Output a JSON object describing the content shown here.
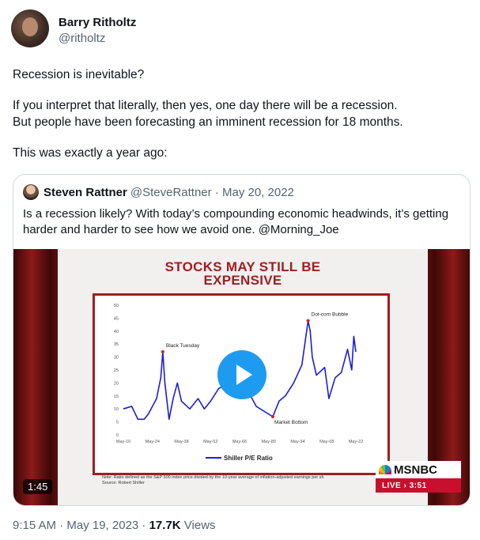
{
  "author": {
    "name": "Barry Ritholtz",
    "handle": "@ritholtz"
  },
  "tweet": {
    "p1": "Recession is inevitable?",
    "p2": "If you interpret that literally, then yes, one day there will be a recession.\nBut people have been forecasting an imminent recession for 18 months.",
    "p3": "This was exactly a year ago:"
  },
  "quote": {
    "name": "Steven Rattner",
    "meta": "@SteveRattner · May 20, 2022",
    "text": "Is a recession likely? With today’s compounding economic headwinds, it’s getting harder and harder to see how we avoid one. @Morning_Joe"
  },
  "video": {
    "slide_title_1": "STOCKS MAY STILL BE",
    "slide_title_2": "EXPENSIVE",
    "duration": "1:45",
    "network": "MSNBC",
    "live": "LIVE › 3:51",
    "note_1": "Note: Ratio defined as the S&P 500 index price divided by the 10-year average of inflation-adjusted earnings per sh",
    "note_2": "Source: Robert Shiller"
  },
  "chart_data": {
    "type": "line",
    "series": [
      {
        "name": "Shiller P/E Ratio",
        "color": "#1a1fd6",
        "x": [
          1910,
          1914,
          1917,
          1920,
          1922,
          1924,
          1926,
          1928,
          1929,
          1930,
          1932,
          1934,
          1936,
          1938,
          1942,
          1946,
          1949,
          1952,
          1956,
          1960,
          1966,
          1970,
          1974,
          1978,
          1980,
          1982,
          1985,
          1988,
          1992,
          1996,
          1999,
          2000,
          2001,
          2003,
          2007,
          2009,
          2012,
          2015,
          2018,
          2020,
          2021,
          2022
        ],
        "y": [
          10,
          11,
          6,
          6,
          8,
          11,
          14,
          22,
          32,
          20,
          6,
          14,
          20,
          13,
          10,
          14,
          10,
          13,
          18,
          19,
          24,
          17,
          11,
          9,
          8,
          7,
          13,
          15,
          20,
          27,
          44,
          40,
          30,
          23,
          26,
          14,
          22,
          24,
          33,
          25,
          38,
          32
        ]
      }
    ],
    "categories": [
      "May-10",
      "May-24",
      "May-38",
      "May-52",
      "May-66",
      "May-80",
      "May-94",
      "May-08",
      "May-22"
    ],
    "yticks": [
      "0",
      "5",
      "10",
      "15",
      "20",
      "25",
      "30",
      "35",
      "40",
      "45",
      "50"
    ],
    "ylim": [
      0,
      50
    ],
    "xlim": [
      1910,
      2022
    ],
    "annotations": [
      {
        "label": "Black Tuesday",
        "x": 1929,
        "y": 32
      },
      {
        "label": "Dot-com Bubble",
        "x": 1999,
        "y": 44
      },
      {
        "label": "Market Bottom",
        "x": 1982,
        "y": 7
      }
    ],
    "legend": "Shiller P/E Ratio"
  },
  "footer": {
    "time": "9:15 AM · May 19, 2023 · ",
    "views_count": "17.7K",
    "views_label": " Views"
  }
}
